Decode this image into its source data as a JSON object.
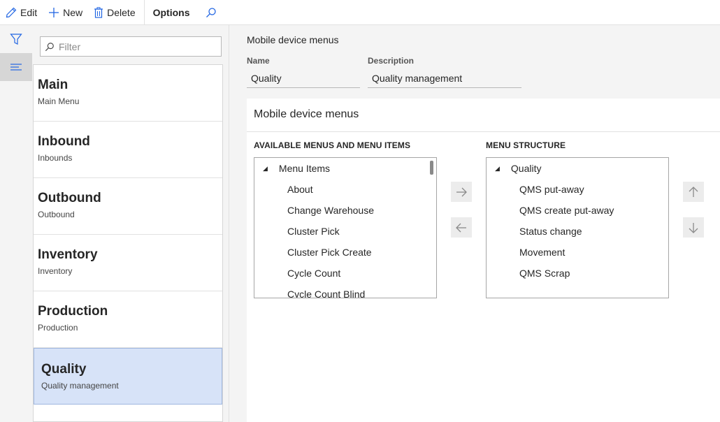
{
  "toolbar": {
    "edit_label": "Edit",
    "new_label": "New",
    "delete_label": "Delete",
    "options_label": "Options"
  },
  "filter": {
    "placeholder": "Filter"
  },
  "menus": [
    {
      "title": "Main",
      "subtitle": "Main Menu"
    },
    {
      "title": "Inbound",
      "subtitle": "Inbounds"
    },
    {
      "title": "Outbound",
      "subtitle": "Outbound"
    },
    {
      "title": "Inventory",
      "subtitle": "Inventory"
    },
    {
      "title": "Production",
      "subtitle": "Production"
    },
    {
      "title": "Quality",
      "subtitle": "Quality management",
      "selected": true
    }
  ],
  "main": {
    "page_title": "Mobile device menus",
    "name_label": "Name",
    "name_value": "Quality",
    "description_label": "Description",
    "description_value": "Quality management",
    "card_title": "Mobile device menus",
    "available_header": "AVAILABLE MENUS AND MENU ITEMS",
    "structure_header": "MENU STRUCTURE",
    "available_root": "Menu Items",
    "available_items": [
      "About",
      "Change Warehouse",
      "Cluster Pick",
      "Cluster Pick Create",
      "Cycle Count",
      "Cycle Count Blind"
    ],
    "structure_root": "Quality",
    "structure_items": [
      "QMS put-away",
      "QMS create put-away",
      "Status change",
      "Movement",
      "QMS Scrap"
    ]
  },
  "colors": {
    "accent": "#2266e3",
    "selected_bg": "#d7e3f8"
  }
}
